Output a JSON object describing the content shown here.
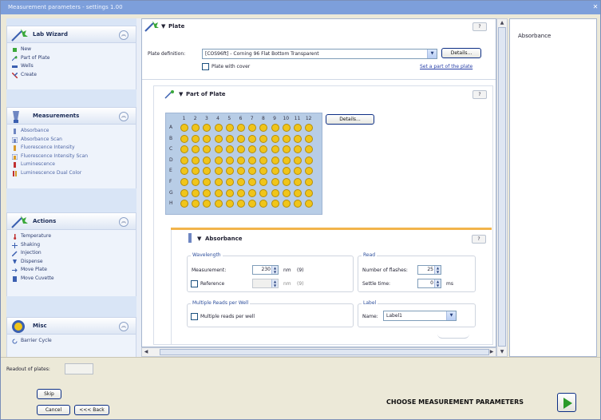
{
  "window": {
    "title": "Measurement parameters - settings 1.00"
  },
  "sidebar": {
    "lab_wizard": {
      "title": "Lab Wizard",
      "items": [
        "New",
        "Part of Plate",
        "Wells",
        "Create"
      ]
    },
    "measurements": {
      "title": "Measurements",
      "items": [
        "Absorbance",
        "Absorbance Scan",
        "Fluorescence Intensity",
        "Fluorescence Intensity Scan",
        "Luminescence",
        "Luminescence Dual Color"
      ]
    },
    "actions": {
      "title": "Actions",
      "items": [
        "Temperature",
        "Shaking",
        "Injection",
        "Dispense",
        "Move Plate",
        "Move Cuvette"
      ]
    },
    "miscellaneous": {
      "title": "Misc",
      "items": [
        "Barrier Cycle"
      ]
    }
  },
  "plate_section": {
    "title": "Plate",
    "help": "?",
    "definition_label": "Plate definition:",
    "definition_value": "[COS96ft] - Corning 96 Flat Bottom Transparent",
    "details_button": "Details...",
    "cover_label": "Plate with cover",
    "select_link": "Set a part of the plate"
  },
  "part_of_plate": {
    "title": "Part of Plate",
    "help": "?",
    "details_button": "Details...",
    "columns": [
      "1",
      "2",
      "3",
      "4",
      "5",
      "6",
      "7",
      "8",
      "9",
      "10",
      "11",
      "12"
    ],
    "rows": [
      "A",
      "B",
      "C",
      "D",
      "E",
      "F",
      "G",
      "H"
    ],
    "well_color": "#f0c51a"
  },
  "absorbance": {
    "title": "Absorbance",
    "help": "?",
    "wavelength_group": "Wavelength",
    "measurement_label": "Measurement:",
    "measurement_value": "230",
    "measurement_unit": "nm",
    "measurement_bw": "(9)",
    "reference_label": "Reference",
    "reference_value": "",
    "reference_unit": "nm",
    "reference_bw": "(9)",
    "read_group": "Read",
    "flashes_label": "Number of flashes:",
    "flashes_value": "25",
    "settle_label": "Settle time:",
    "settle_value": "0",
    "settle_unit": "ms",
    "multiple_group": "Multiple Reads per Well",
    "multiple_label": "Multiple reads per well",
    "label_group": "Label",
    "name_label": "Name:",
    "name_value": "Label1"
  },
  "right_panel": {
    "title": "Absorbance"
  },
  "bottom": {
    "readout_label": "Readout of plates:",
    "skip_button": "Skip",
    "cancel_button": "Cancel",
    "back_button": "<<< Back",
    "step_title": "CHOOSE MEASUREMENT PARAMETERS"
  }
}
